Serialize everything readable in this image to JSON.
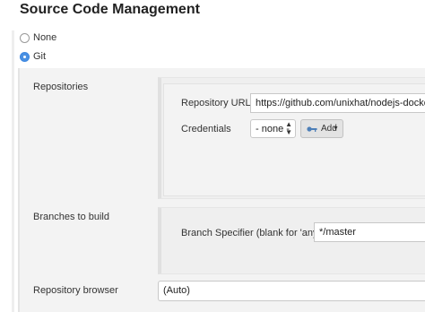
{
  "section_title": "Source Code Management",
  "scm_options": [
    {
      "label": "None",
      "selected": false
    },
    {
      "label": "Git",
      "selected": true
    }
  ],
  "repositories": {
    "label": "Repositories",
    "url_label": "Repository URL",
    "url_value": "https://github.com/unixhat/nodejs-docker",
    "credentials_label": "Credentials",
    "credentials_value": "- none -",
    "add_label": "Add"
  },
  "branches": {
    "label": "Branches to build",
    "specifier_label": "Branch Specifier (blank for 'any')",
    "specifier_value": "*/master"
  },
  "repository_browser": {
    "label": "Repository browser",
    "value": "(Auto)"
  },
  "colors": {
    "accent": "#4a90e2",
    "panel": "#f3f3f3"
  },
  "icons": [
    "key-icon",
    "dropdown-arrow-icon",
    "select-arrows-icon"
  ]
}
